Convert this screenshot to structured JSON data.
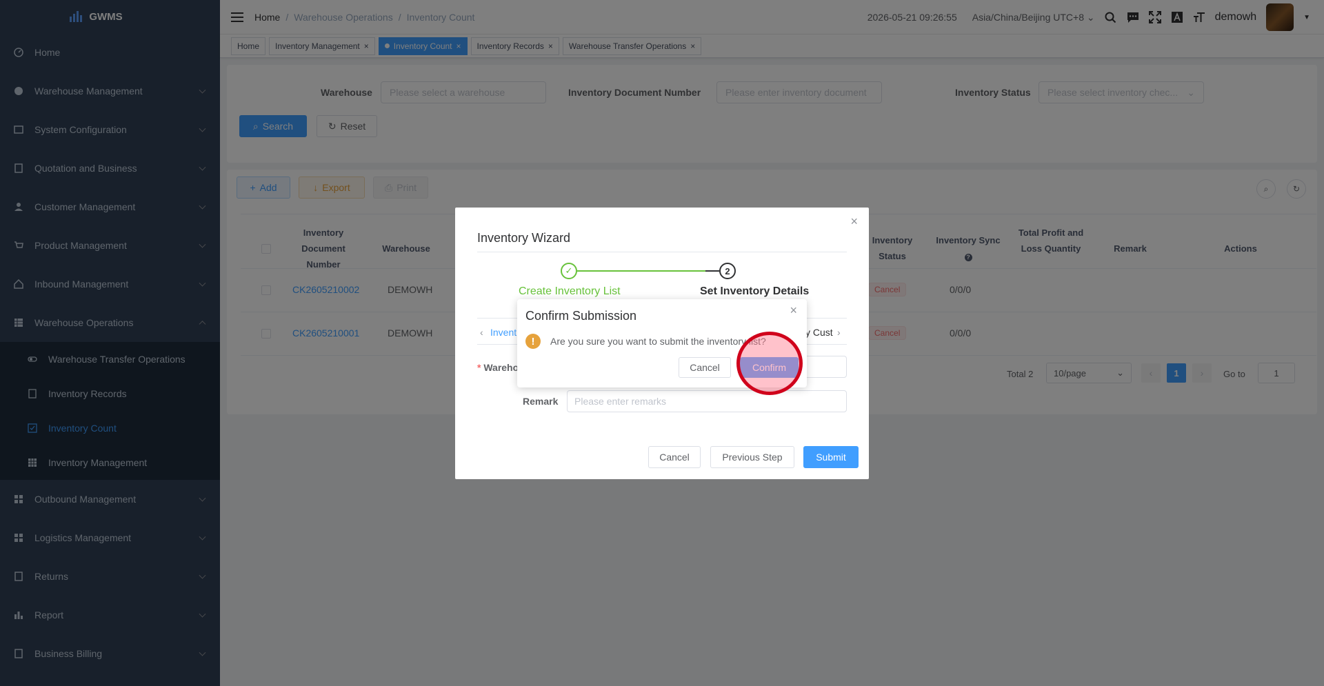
{
  "app": {
    "name": "GWMS"
  },
  "sidebar": {
    "items": [
      {
        "label": "Home",
        "icon": "dashboard-icon"
      },
      {
        "label": "Warehouse Management",
        "icon": "globe-icon"
      },
      {
        "label": "System Configuration",
        "icon": "settings-list-icon"
      },
      {
        "label": "Quotation and Business",
        "icon": "document-icon"
      },
      {
        "label": "Customer Management",
        "icon": "user-icon"
      },
      {
        "label": "Product Management",
        "icon": "cart-icon"
      },
      {
        "label": "Inbound Management",
        "icon": "house-icon"
      },
      {
        "label": "Warehouse Operations",
        "icon": "grid-icon"
      }
    ],
    "submenu": [
      {
        "label": "Warehouse Transfer Operations"
      },
      {
        "label": "Inventory Records"
      },
      {
        "label": "Inventory Count"
      },
      {
        "label": "Inventory Management"
      }
    ],
    "items_after": [
      {
        "label": "Outbound Management",
        "icon": "grid-icon"
      },
      {
        "label": "Logistics Management",
        "icon": "grid-icon"
      },
      {
        "label": "Returns",
        "icon": "document-icon"
      },
      {
        "label": "Report",
        "icon": "bar-chart-icon"
      },
      {
        "label": "Business Billing",
        "icon": "document-icon"
      }
    ]
  },
  "navbar": {
    "breadcrumb": [
      "Home",
      "/",
      "Warehouse Operations",
      "/",
      "Inventory Count"
    ],
    "datetime": "2026-05-21 09:26:55",
    "timezone": "Asia/China/Beijing UTC+8",
    "username": "demowh"
  },
  "tags": [
    {
      "label": "Home"
    },
    {
      "label": "Inventory Management"
    },
    {
      "label": "Inventory Count"
    },
    {
      "label": "Inventory Records"
    },
    {
      "label": "Warehouse Transfer Operations"
    }
  ],
  "filter": {
    "warehouse_label": "Warehouse",
    "warehouse_placeholder": "Please select a warehouse",
    "doc_label": "Inventory Document Number",
    "doc_placeholder": "Please enter inventory document",
    "status_label": "Inventory Status",
    "status_placeholder": "Please select inventory chec...",
    "search": "Search",
    "reset": "Reset"
  },
  "toolbar": {
    "add": "Add",
    "export": "Export",
    "print": "Print"
  },
  "table": {
    "headers": {
      "doc": "Inventory Document Number",
      "warehouse": "Warehouse",
      "status": "Inventory Status",
      "sync": "Inventory Sync",
      "profit": "Total Profit and Loss Quantity",
      "remark": "Remark",
      "actions": "Actions"
    },
    "rows": [
      {
        "doc": "CK2605210002",
        "warehouse": "DEMOWH",
        "status": "Cancel",
        "sync": "0/0/0"
      },
      {
        "doc": "CK2605210001",
        "warehouse": "DEMOWH",
        "status": "Cancel",
        "sync": "0/0/0"
      }
    ],
    "total": "Total 2",
    "page_size": "10/page",
    "page": "1",
    "goto_label": "Go to",
    "goto_value": "1"
  },
  "wizard": {
    "title": "Inventory Wizard",
    "step1": "Create Inventory List",
    "step2_num": "2",
    "step2": "Set Inventory Details",
    "tab_left": "Invent",
    "tab_right": "y Cust",
    "warehouse_label": "Wareho",
    "remark_label": "Remark",
    "remark_placeholder": "Please enter remarks",
    "cancel": "Cancel",
    "prev": "Previous Step",
    "submit": "Submit"
  },
  "confirm_dialog": {
    "title": "Confirm Submission",
    "message": "Are you sure you want to submit the inventory list?",
    "cancel": "Cancel",
    "confirm": "Confirm"
  },
  "colors": {
    "primary": "#409eff",
    "sidebar": "#304156",
    "success": "#67c23a",
    "warning": "#e6a23c",
    "danger": "#f56c6c"
  }
}
